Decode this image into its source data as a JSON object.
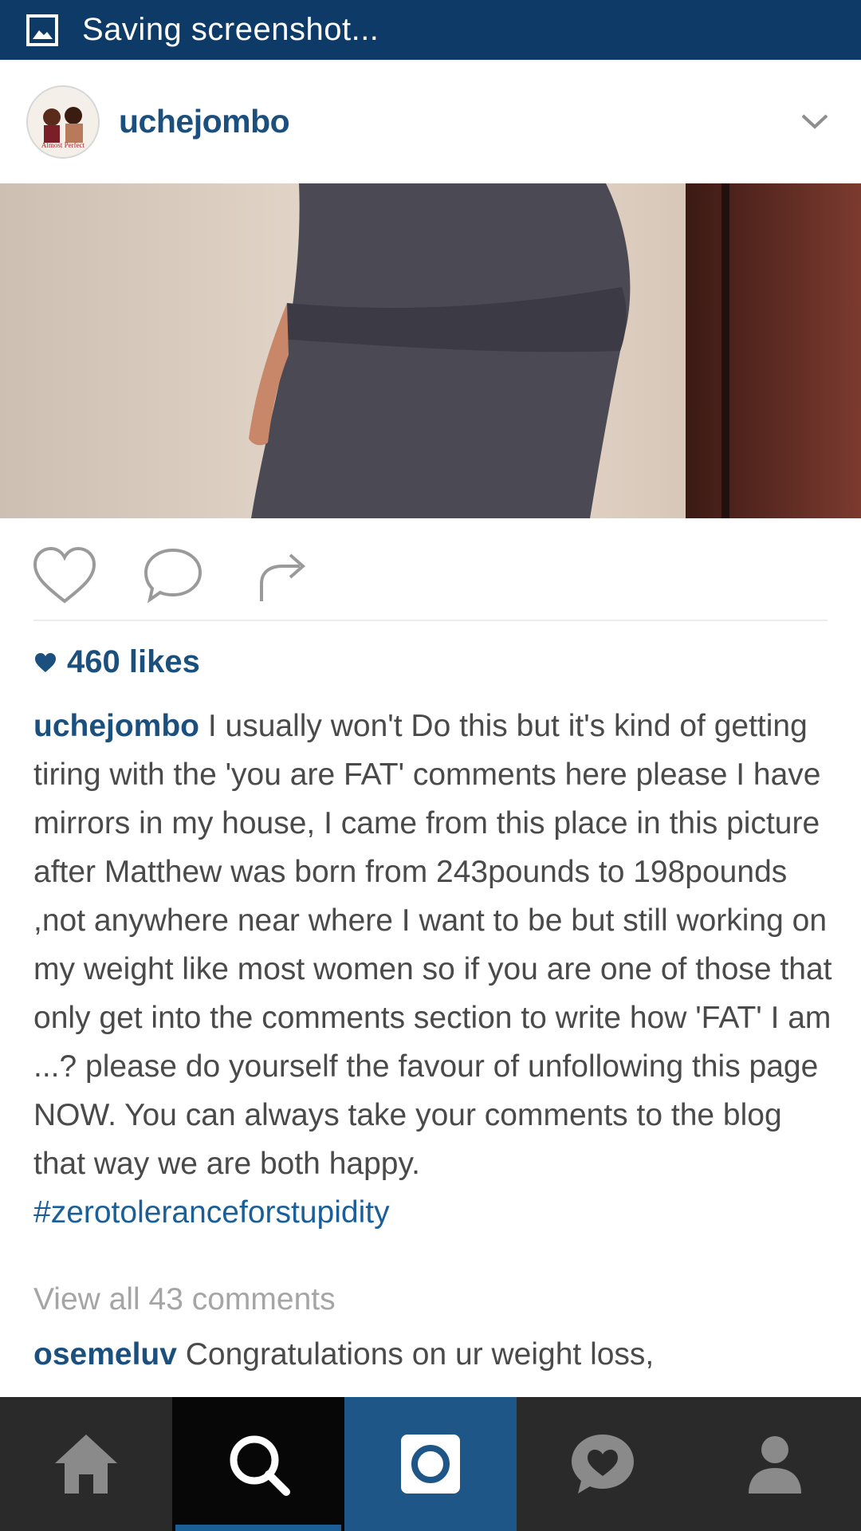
{
  "status_bar": {
    "icon": "image-icon",
    "text": "Saving screenshot..."
  },
  "post": {
    "username": "uchejombo",
    "avatar": {
      "icon": "profile-photo",
      "text": "Almost Perfect"
    },
    "menu_icon": "chevron-down-icon",
    "likes_icon": "heart-icon",
    "likes": "460 likes",
    "actions": [
      "heart-icon",
      "comment-icon",
      "share-icon"
    ],
    "caption": {
      "username": "uchejombo",
      "text": "I usually won't Do this but it's kind of getting tiring with the 'you are FAT' comments here please I have mirrors in my house, I came from this place in this picture after Matthew was born from 243pounds to 198pounds ,not anywhere near where I want to be but still working on my weight like most women so if you are one of those that only get into the comments section to write how 'FAT' I am ...? please do yourself the favour of unfollowing this page NOW. You can always take your comments to the blog that way we are both happy.",
      "hashtag": "#zerotoleranceforstupidity"
    },
    "view_all_comments": "View all 43 comments",
    "first_comment": {
      "username": "osemeluv",
      "text": "Congratulations on ur weight loss,"
    }
  },
  "bottom_nav": {
    "items": [
      "home-icon",
      "search-icon",
      "camera-icon",
      "activity-icon",
      "profile-icon"
    ],
    "active": "search-icon"
  }
}
